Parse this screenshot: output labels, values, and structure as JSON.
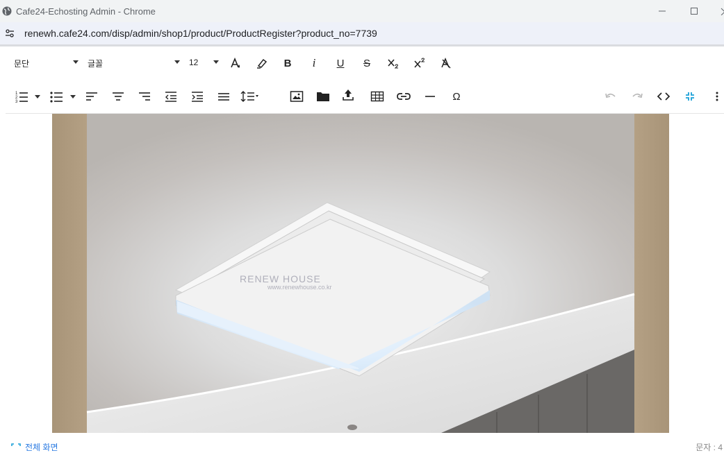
{
  "window": {
    "title": "Cafe24-Echosting Admin - Chrome"
  },
  "addressbar": {
    "url": "renewh.cafe24.com/disp/admin/shop1/product/ProductRegister?product_no=7739"
  },
  "toolbar": {
    "paragraph_select": "문단",
    "font_select": "글꼴",
    "size_select": "12",
    "bold": "B",
    "italic": "i",
    "underline": "U",
    "strike": "S",
    "omega": "Ω"
  },
  "content": {
    "watermark_brand": "RENEW HOUSE",
    "watermark_url": "www.renewhouse.co.kr"
  },
  "footer": {
    "fullscreen_label": "전체 화면",
    "char_count_label": "문자 : 4"
  },
  "colors": {
    "accent": "#2a7ae2",
    "fullscreen_icon": "#1aa0d8"
  }
}
